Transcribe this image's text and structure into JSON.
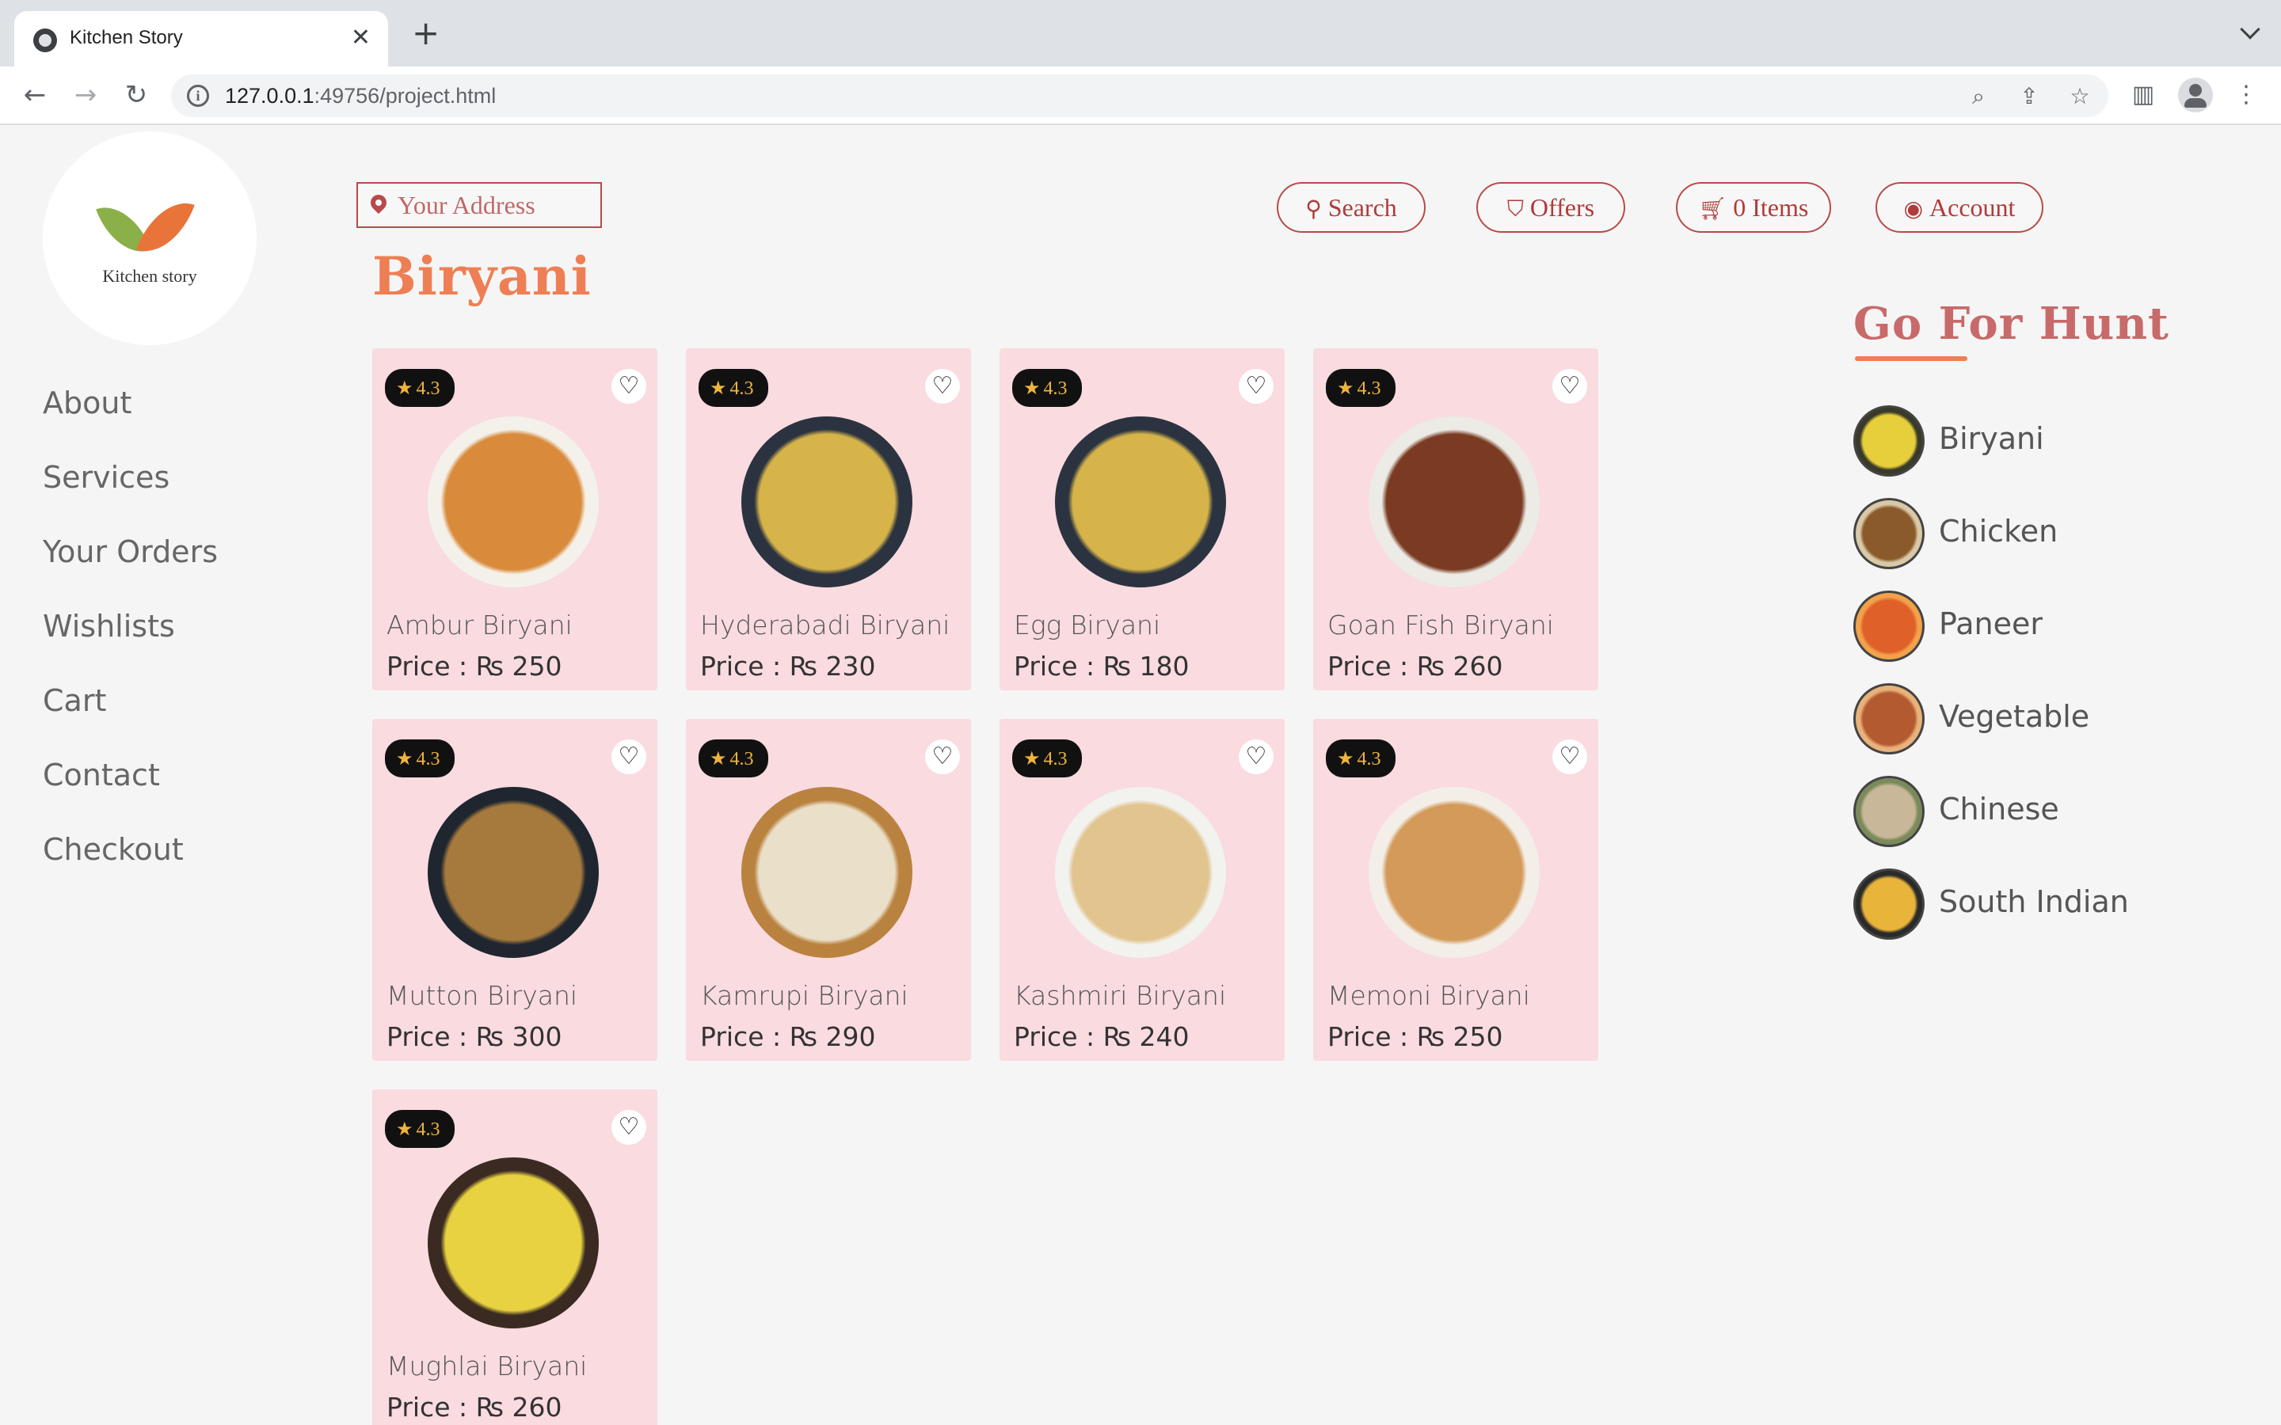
{
  "browser": {
    "tab_title": "Kitchen Story",
    "url_host": "127.0.0.1",
    "url_rest": ":49756/project.html"
  },
  "logo": {
    "text": "Kitchen story"
  },
  "sidebar": {
    "items": [
      {
        "label": "About"
      },
      {
        "label": "Services"
      },
      {
        "label": "Your Orders"
      },
      {
        "label": "Wishlists"
      },
      {
        "label": "Cart"
      },
      {
        "label": "Contact"
      },
      {
        "label": "Checkout"
      }
    ]
  },
  "header": {
    "address_placeholder": "Your Address",
    "search_label": "Search",
    "offers_label": "Offers",
    "cart_label": "0 Items",
    "account_label": "Account"
  },
  "section": {
    "title": "Biryani"
  },
  "products": [
    {
      "rating": "4.3",
      "name": "Ambur Biryani",
      "price": "Price : ₨ 250",
      "colors": [
        "#d98a3a",
        "#f4f1ea"
      ]
    },
    {
      "rating": "4.3",
      "name": "Hyderabadi Biryani",
      "price": "Price : ₨ 230",
      "colors": [
        "#d6b44a",
        "#2b3340"
      ]
    },
    {
      "rating": "4.3",
      "name": "Egg Biryani",
      "price": "Price : ₨ 180",
      "colors": [
        "#d6b44a",
        "#2b3340"
      ]
    },
    {
      "rating": "4.3",
      "name": "Goan Fish Biryani",
      "price": "Price : ₨ 260",
      "colors": [
        "#7a3b22",
        "#ecebe6"
      ]
    },
    {
      "rating": "4.3",
      "name": "Mutton Biryani",
      "price": "Price : ₨ 300",
      "colors": [
        "#a67a3c",
        "#1f2630"
      ]
    },
    {
      "rating": "4.3",
      "name": "Kamrupi Biryani",
      "price": "Price : ₨ 290",
      "colors": [
        "#eadfc8",
        "#b9823f"
      ]
    },
    {
      "rating": "4.3",
      "name": "Kashmiri Biryani",
      "price": "Price : ₨ 240",
      "colors": [
        "#e2c48e",
        "#f2f2ef"
      ]
    },
    {
      "rating": "4.3",
      "name": "Memoni Biryani",
      "price": "Price : ₨ 250",
      "colors": [
        "#d39a5a",
        "#f3efe8"
      ]
    },
    {
      "rating": "4.3",
      "name": "Mughlai Biryani",
      "price": "Price : ₨ 260",
      "colors": [
        "#e8d240",
        "#3a2a22"
      ]
    }
  ],
  "hunt": {
    "title": "Go For Hunt",
    "items": [
      {
        "label": "Biryani",
        "colors": [
          "#e6cf3a",
          "#3a3a2a"
        ]
      },
      {
        "label": "Chicken",
        "colors": [
          "#8b5a2b",
          "#d9c9a8"
        ]
      },
      {
        "label": "Paneer",
        "colors": [
          "#e0602a",
          "#f2a24a"
        ]
      },
      {
        "label": "Vegetable",
        "colors": [
          "#b45a30",
          "#e8b27a"
        ]
      },
      {
        "label": "Chinese",
        "colors": [
          "#c9b79a",
          "#7a8a5a"
        ]
      },
      {
        "label": "South Indian",
        "colors": [
          "#e9b43a",
          "#2a2a2a"
        ]
      }
    ]
  }
}
